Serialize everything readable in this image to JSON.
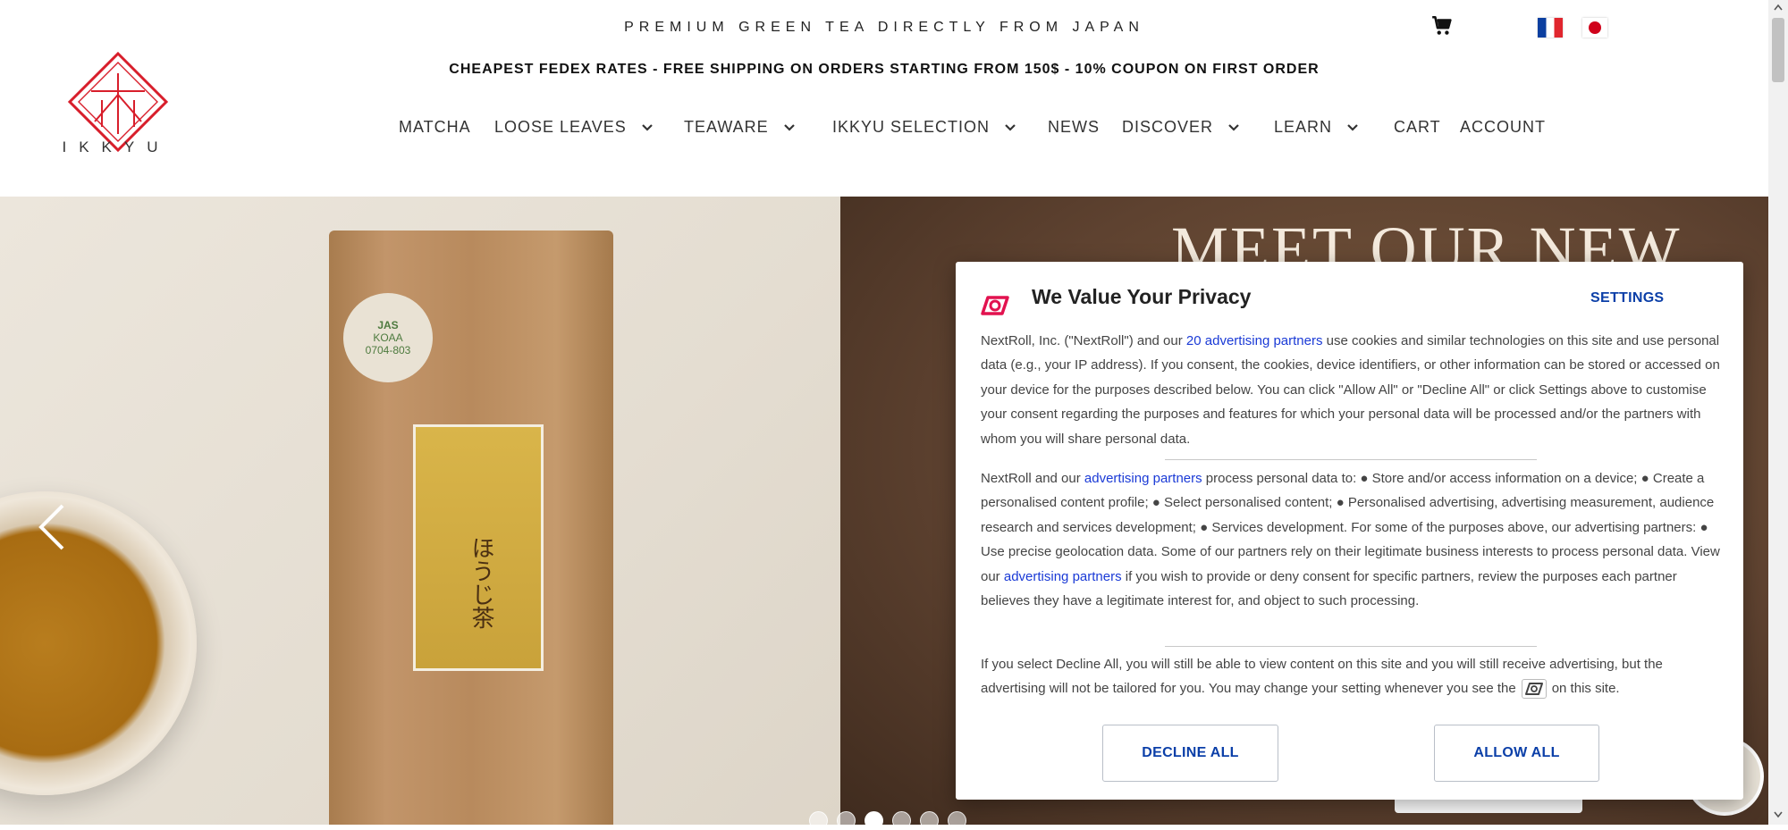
{
  "header": {
    "tagline": "PREMIUM GREEN TEA DIRECTLY FROM JAPAN",
    "promo": "CHEAPEST FEDEX RATES - FREE SHIPPING ON ORDERS STARTING FROM 150$ - 10% COUPON ON FIRST ORDER",
    "logo_text": "IKKYU",
    "cart_icon": "cart-icon",
    "languages": [
      "fr-flag-icon",
      "jp-flag-icon"
    ]
  },
  "nav": {
    "items": [
      {
        "label": "MATCHA",
        "dropdown": false
      },
      {
        "label": "LOOSE LEAVES",
        "dropdown": true
      },
      {
        "label": "TEAWARE",
        "dropdown": true
      },
      {
        "label": "IKKYU SELECTION",
        "dropdown": true
      },
      {
        "label": "NEWS",
        "dropdown": false
      },
      {
        "label": "DISCOVER",
        "dropdown": true
      },
      {
        "label": "LEARN",
        "dropdown": true
      },
      {
        "label": "CART",
        "dropdown": false
      },
      {
        "label": "ACCOUNT",
        "dropdown": false
      }
    ]
  },
  "hero": {
    "heading": "MEET OUR NEW",
    "slide_count": 6,
    "active_slide": 3,
    "bag_seal_line1": "JAS",
    "bag_seal_line2": "KOAA",
    "bag_seal_line3": "0704-803",
    "bag_label": "ほうじ茶"
  },
  "consent": {
    "title": "We Value Your Privacy",
    "settings_label": "SETTINGS",
    "p1_a": "NextRoll, Inc. (\"NextRoll\") and our ",
    "p1_link": "20 advertising partners",
    "p1_b": " use cookies and similar technologies on this site and use personal data (e.g., your IP address). If you consent, the cookies, device identifiers, or other information can be stored or accessed on your device for the purposes described below. You can click \"Allow All\" or \"Decline All\" or click Settings above to customise your consent regarding the purposes and features for which your personal data will be processed and/or the partners with whom you will share personal data.",
    "p2_a": "NextRoll and our ",
    "p2_link": "advertising partners",
    "p2_b": " process personal data to: ● Store and/or access information on a device; ● Create a personalised content profile; ● Select personalised content; ● Personalised advertising, advertising measurement, audience research and services development; ● Services development. For some of the purposes above, our advertising partners: ● Use precise geolocation data. Some of our partners rely on their legitimate business interests to process personal data. View our ",
    "p2_link2": "advertising partners",
    "p2_c": " if you wish to provide or deny consent for specific partners, review the purposes each partner believes they have a legitimate interest for, and object to such processing.",
    "p3_a": "If you select Decline All, you will still be able to view content on this site and you will still receive advertising, but the advertising will not be tailored for you. You may change your setting whenever you see the",
    "p3_b": "on this site.",
    "decline_label": "DECLINE ALL",
    "allow_label": "ALLOW ALL",
    "brand_color": "#e2124f",
    "link_color": "#1a3ad6",
    "button_color": "#0b3fa8"
  }
}
